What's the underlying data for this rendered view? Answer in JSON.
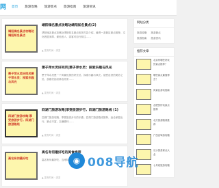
{
  "header": {
    "logo_text": "网",
    "nav": [
      "首页",
      "旅游攻略",
      "旅游景点",
      "旅游指南",
      "旅游资讯"
    ]
  },
  "articles": [
    {
      "thumb_text": "靖阳嗨名景点攻略功靖阳知名景点",
      "title": "靖阳嗨名景点攻略功靖阳知名景点(2)",
      "text": "靖阳嗨名景点攻略功靖阳知名景点相关内容介绍，值得一游景区景点推荐，文化底蕴深厚，景色宜人，游客可自行前往……",
      "meta": "▲ 发布时间 · 浏览"
    },
    {
      "thumb_text": "萧子萍水灵好同风萧子萍水灵：探索乐趣与风光",
      "title": "萧子萍水灵好同风|萧子萍水灵：探索乐趣与风光",
      "text": "萧子萍水灵是一个风景优美的好去处，探索乐趣与风光，感受自然的美妙之处，游客们纷纷慕名而来……",
      "meta": "▲ 发布时间 · 浏览"
    },
    {
      "thumb_text": "四湖门旅游攻略|享受旅游步行，四湖门旅游路线",
      "title": "四湖门旅游攻略|享受旅游步行，四湖门旅游路线 (1)",
      "text": "四湖门旅游攻略，享受旅游步行的乐趣，四湖门旅游路线推荐，适合家庭出行，景点丰富，交通便利……",
      "meta": "▲ 发布时间 · 浏览"
    },
    {
      "thumb_text": "高名有何最好吃",
      "title": "高名有何最好吃的美食推荐",
      "text": "高名有何最好吃，当地特色美食推荐……",
      "meta": "▲ 发布时间 · 浏览"
    }
  ],
  "sidebar": {
    "links_title": "网站分类",
    "links": [
      "旅游攻略",
      "旅游景点",
      "旅游指南",
      "旅游资讯"
    ],
    "recommend_title": "推荐文章",
    "recommend": [
      "北京有哪些好玩的景点推荐？",
      "哪些景点最值得去？",
      "风景区游玩指南",
      "合肥的好玩景点推荐",
      "北方旅游路线推荐",
      "广西自驾游攻略",
      "长沙旅游景点大全",
      "七号线旅游攻略"
    ]
  },
  "watermark": {
    "icon": "◉",
    "text": "008导航"
  }
}
